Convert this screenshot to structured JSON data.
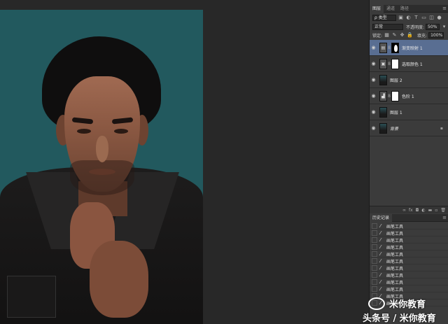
{
  "panels": {
    "layers": {
      "tabs": [
        "图层",
        "通道",
        "路径"
      ],
      "filter_kind": "ρ 类型",
      "blend_mode": "正常",
      "opacity_label": "不透明度:",
      "opacity_value": "50%",
      "lock_label": "锁定:",
      "fill_label": "填充:",
      "fill_value": "100%",
      "items": [
        {
          "name": "渐变映射 1",
          "kind": "adjustment",
          "selected": true
        },
        {
          "name": "选取颜色 1",
          "kind": "adjustment",
          "selected": false
        },
        {
          "name": "图层 2",
          "kind": "pixel",
          "selected": false
        },
        {
          "name": "色阶 1",
          "kind": "adjustment",
          "selected": false
        },
        {
          "name": "图层 1",
          "kind": "pixel",
          "selected": false
        },
        {
          "name": "背景",
          "kind": "background",
          "selected": false
        }
      ],
      "footer_icons": [
        "link-icon",
        "fx-icon",
        "mask-icon",
        "adjustment-icon",
        "folder-icon",
        "new-layer-icon",
        "trash-icon"
      ]
    },
    "history": {
      "tab": "历史记录",
      "items": [
        "画笔工具",
        "画笔工具",
        "画笔工具",
        "画笔工具",
        "画笔工具",
        "画笔工具",
        "画笔工具",
        "画笔工具",
        "画笔工具",
        "画笔工具",
        "画笔工具",
        "画笔工具"
      ]
    }
  },
  "watermark": {
    "name": "米你教育",
    "line": "头条号 / 米你教育"
  },
  "colors": {
    "canvas_bg": "#22595e",
    "selected_layer": "#596e92",
    "panel_bg": "#3b3b3b"
  }
}
